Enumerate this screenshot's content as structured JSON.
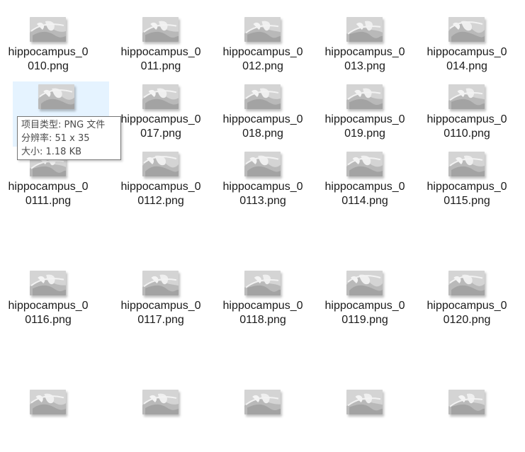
{
  "files": [
    {
      "line1": "hippocampus_0",
      "line2": "010.png"
    },
    {
      "line1": "hippocampus_0",
      "line2": "011.png"
    },
    {
      "line1": "hippocampus_0",
      "line2": "012.png"
    },
    {
      "line1": "hippocampus_0",
      "line2": "013.png"
    },
    {
      "line1": "hippocampus_0",
      "line2": "014.png"
    },
    {
      "line1": "",
      "line2": ""
    },
    {
      "line1": "hippocampus_0",
      "line2": "017.png"
    },
    {
      "line1": "hippocampus_0",
      "line2": "018.png"
    },
    {
      "line1": "hippocampus_0",
      "line2": "019.png"
    },
    {
      "line1": "hippocampus_0",
      "line2": "0110.png"
    },
    {
      "line1": "hippocampus_0",
      "line2": "0111.png"
    },
    {
      "line1": "hippocampus_0",
      "line2": "0112.png"
    },
    {
      "line1": "hippocampus_0",
      "line2": "0113.png"
    },
    {
      "line1": "hippocampus_0",
      "line2": "0114.png"
    },
    {
      "line1": "hippocampus_0",
      "line2": "0115.png"
    },
    {
      "line1": "hippocampus_0",
      "line2": "0116.png"
    },
    {
      "line1": "hippocampus_0",
      "line2": "0117.png"
    },
    {
      "line1": "hippocampus_0",
      "line2": "0118.png"
    },
    {
      "line1": "hippocampus_0",
      "line2": "0119.png"
    },
    {
      "line1": "hippocampus_0",
      "line2": "0120.png"
    },
    {
      "line1": "",
      "line2": ""
    },
    {
      "line1": "",
      "line2": ""
    },
    {
      "line1": "",
      "line2": ""
    },
    {
      "line1": "",
      "line2": ""
    },
    {
      "line1": "",
      "line2": ""
    }
  ],
  "hovered_index": 5,
  "tooltip": {
    "type_line": "项目类型: PNG 文件",
    "resolution_line": "分辨率: 51 x 35",
    "size_line": "大小: 1.18 KB"
  },
  "colors": {
    "hover_background": "#e5f3ff",
    "text": "#1a1a1a",
    "tooltip_border": "#767676"
  },
  "icons": {
    "thumbnail": "png-thumbnail-icon"
  }
}
